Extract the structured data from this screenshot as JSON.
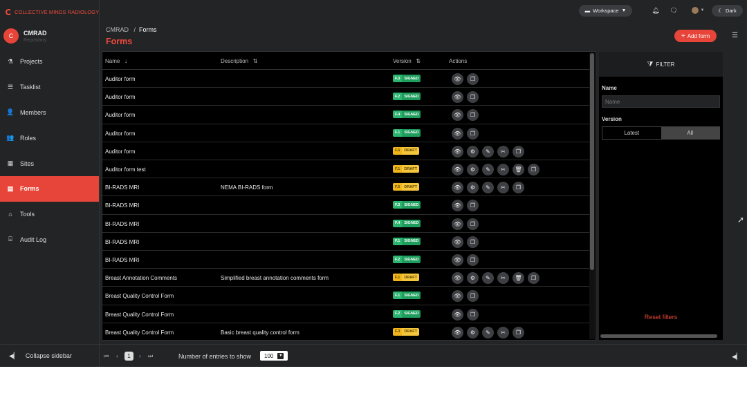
{
  "brand": {
    "name": "COLLECTIVE MINDS RADIOLOGY",
    "color": "#ef4a3c"
  },
  "org": {
    "initial": "C",
    "name": "CMRAD",
    "subtitle": "Repository"
  },
  "nav": [
    {
      "label": "Projects",
      "icon": "flask-icon",
      "glyph": "⚗",
      "active": false
    },
    {
      "label": "Tasklist",
      "icon": "list-icon",
      "glyph": "☰",
      "active": false
    },
    {
      "label": "Members",
      "icon": "user-icon",
      "glyph": "👤",
      "active": false
    },
    {
      "label": "Roles",
      "icon": "users-icon",
      "glyph": "👥",
      "active": false
    },
    {
      "label": "Sites",
      "icon": "building-icon",
      "glyph": "▦",
      "active": false
    },
    {
      "label": "Forms",
      "icon": "table-icon",
      "glyph": "▤",
      "active": true
    },
    {
      "label": "Tools",
      "icon": "toolbox-icon",
      "glyph": "⌂",
      "active": false
    },
    {
      "label": "Audit Log",
      "icon": "audit-icon",
      "glyph": "⌸",
      "active": false
    }
  ],
  "collapse_label": "Collapse sidebar",
  "topbar": {
    "workspace_label": "Workspace",
    "theme_label": "Dark"
  },
  "breadcrumb": {
    "root": "CMRAD",
    "sep": "/",
    "current": "Forms"
  },
  "page_title": "Forms",
  "add_button": "Add form",
  "columns": {
    "name": "Name",
    "description": "Description",
    "version": "Version",
    "actions": "Actions",
    "name_sort": "↓",
    "desc_sort": "⇅",
    "ver_sort": "⇅"
  },
  "rows": [
    {
      "name": "Auditor form",
      "description": "",
      "version": "F.3",
      "status": "SIGNED",
      "actions": [
        "view",
        "copy"
      ]
    },
    {
      "name": "Auditor form",
      "description": "",
      "version": "F.2",
      "status": "SIGNED",
      "actions": [
        "view",
        "copy"
      ]
    },
    {
      "name": "Auditor form",
      "description": "",
      "version": "F.4",
      "status": "SIGNED",
      "actions": [
        "view",
        "copy"
      ]
    },
    {
      "name": "Auditor form",
      "description": "",
      "version": "F.1",
      "status": "SIGNED",
      "actions": [
        "view",
        "copy"
      ]
    },
    {
      "name": "Auditor form",
      "description": "",
      "version": "F.5",
      "status": "DRAFT",
      "actions": [
        "view",
        "settings",
        "edit",
        "sign",
        "copy"
      ]
    },
    {
      "name": "Auditor form test",
      "description": "",
      "version": "F.1",
      "status": "DRAFT",
      "actions": [
        "view",
        "settings",
        "edit",
        "sign",
        "delete",
        "copy"
      ]
    },
    {
      "name": "BI-RADS MRI",
      "description": "NEMA BI-RADS form",
      "version": "F.5",
      "status": "DRAFT",
      "actions": [
        "view",
        "settings",
        "edit",
        "sign",
        "copy"
      ]
    },
    {
      "name": "BI-RADS MRI",
      "description": "",
      "version": "F.3",
      "status": "SIGNED",
      "actions": [
        "view",
        "copy"
      ]
    },
    {
      "name": "BI-RADS MRI",
      "description": "",
      "version": "F.4",
      "status": "SIGNED",
      "actions": [
        "view",
        "copy"
      ]
    },
    {
      "name": "BI-RADS MRI",
      "description": "",
      "version": "F.1",
      "status": "SIGNED",
      "actions": [
        "view",
        "copy"
      ]
    },
    {
      "name": "BI-RADS MRI",
      "description": "",
      "version": "F.2",
      "status": "SIGNED",
      "actions": [
        "view",
        "copy"
      ]
    },
    {
      "name": "Breast Annotation Comments",
      "description": "Simplified breast annotation comments form",
      "version": "F.1",
      "status": "DRAFT",
      "actions": [
        "view",
        "settings",
        "edit",
        "sign",
        "delete",
        "copy"
      ]
    },
    {
      "name": "Breast Quality Control Form",
      "description": "",
      "version": "F.1",
      "status": "SIGNED",
      "actions": [
        "view",
        "copy"
      ]
    },
    {
      "name": "Breast Quality Control Form",
      "description": "",
      "version": "F.2",
      "status": "SIGNED",
      "actions": [
        "view",
        "copy"
      ]
    },
    {
      "name": "Breast Quality Control Form",
      "description": "Basic breast quality control form",
      "version": "F.3",
      "status": "DRAFT",
      "actions": [
        "view",
        "settings",
        "edit",
        "sign",
        "copy"
      ]
    }
  ],
  "filter": {
    "title": "FILTER",
    "name_label": "Name",
    "name_placeholder": "Name",
    "version_label": "Version",
    "version_options": [
      "Latest",
      "All"
    ],
    "version_selected": "All",
    "reset_label": "Reset filters"
  },
  "pagination": {
    "first": "⏮",
    "prev": "‹",
    "page": "1",
    "next": "›",
    "last": "⏭",
    "entries_label": "Number of entries to show",
    "entries_value": "100"
  },
  "colors": {
    "accent": "#e8453a",
    "signed": "#2bb56f",
    "draft": "#f1b51c",
    "bg": "#222426",
    "table_bg": "#000000"
  }
}
